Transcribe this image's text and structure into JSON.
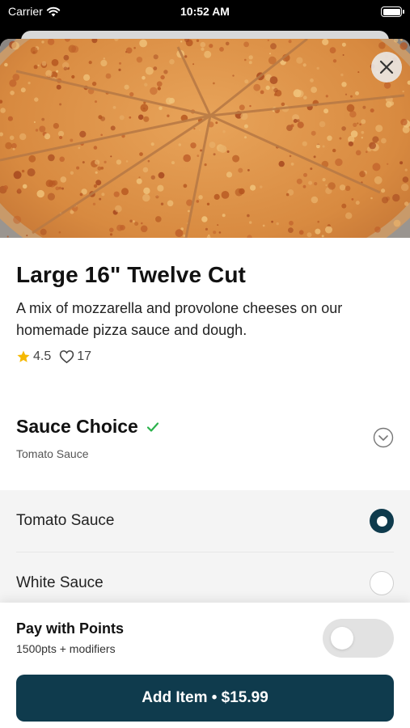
{
  "status_bar": {
    "carrier": "Carrier",
    "time": "10:52 AM"
  },
  "item": {
    "title": "Large 16\" Twelve Cut",
    "description": "A mix of mozzarella and provolone cheeses on our homemade pizza sauce and dough.",
    "rating": "4.5",
    "likes": "17",
    "image_icon": "pizza-photo"
  },
  "sauce_section": {
    "title": "Sauce Choice",
    "selected": "Tomato Sauce",
    "options": [
      {
        "label": "Tomato Sauce",
        "selected": true
      },
      {
        "label": "White Sauce",
        "selected": false
      }
    ]
  },
  "points": {
    "title": "Pay with Points",
    "subtitle": "1500pts + modifiers",
    "enabled": false
  },
  "add_button": {
    "label": "Add Item • $15.99"
  },
  "colors": {
    "primary": "#0f3b4d",
    "check": "#2bb24c",
    "star": "#f5b800"
  }
}
